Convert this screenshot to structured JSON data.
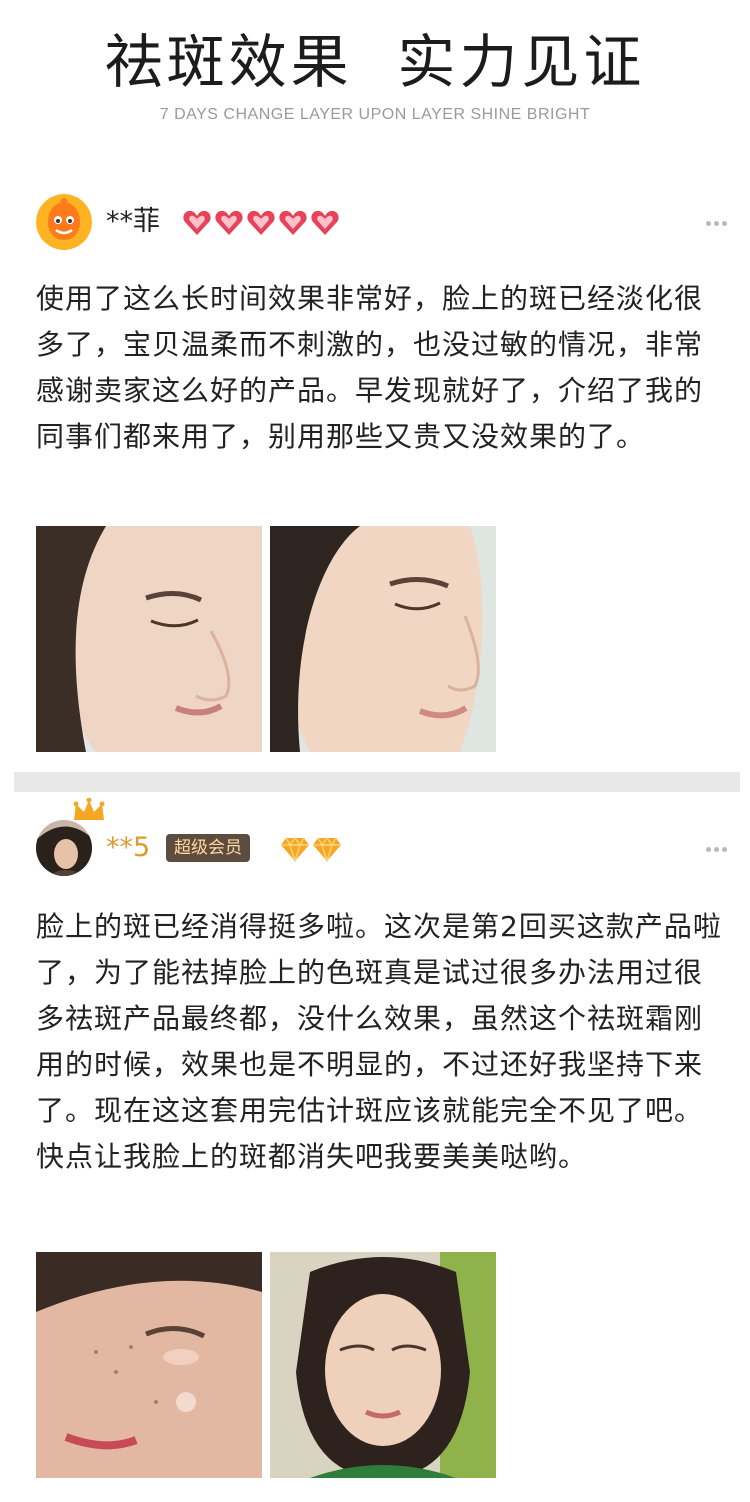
{
  "header": {
    "title": "祛斑效果  实力见证",
    "subtitle": "7 DAYS CHANGE LAYER UPON LAYER SHINE BRIGHT"
  },
  "reviews": [
    {
      "username": "**菲",
      "level_icon": "heart-badge-icon",
      "level_count": 5,
      "more_icon": "more-dots-icon",
      "text": "使用了这么长时间效果非常好，脸上的斑已经淡化很多了，宝贝温柔而不刺激的，也没过敏的情况，非常感谢卖家这么好的产品。早发现就好了，介绍了我的同事们都来用了，别用那些又贵又没效果的了。",
      "photos": [
        "face-photo",
        "face-photo"
      ]
    },
    {
      "username": "**5",
      "vip_label": "超级会员",
      "level_icon": "diamond-badge-icon",
      "level_count": 2,
      "more_icon": "more-dots-icon",
      "text": "脸上的斑已经消得挺多啦。这次是第2回买这款产品啦了，为了能祛掉脸上的色斑真是试过很多办法用过很多祛斑产品最终都，没什么效果，虽然这个祛斑霜刚用的时候，效果也是不明显的，不过还好我坚持下来了。现在这这套用完估计斑应该就能完全不见了吧。快点让我脸上的斑都消失吧我要美美哒哟。",
      "photos": [
        "face-photo",
        "face-photo"
      ]
    }
  ],
  "colors": {
    "divider": "#e8e8e8",
    "vip_badge_bg": "#5e4c3e",
    "vip_badge_text": "#ffd9a3",
    "gold_name": "#e19a2c",
    "heart_badge": "#e8415a",
    "diamond_badge": "#f5a623"
  }
}
